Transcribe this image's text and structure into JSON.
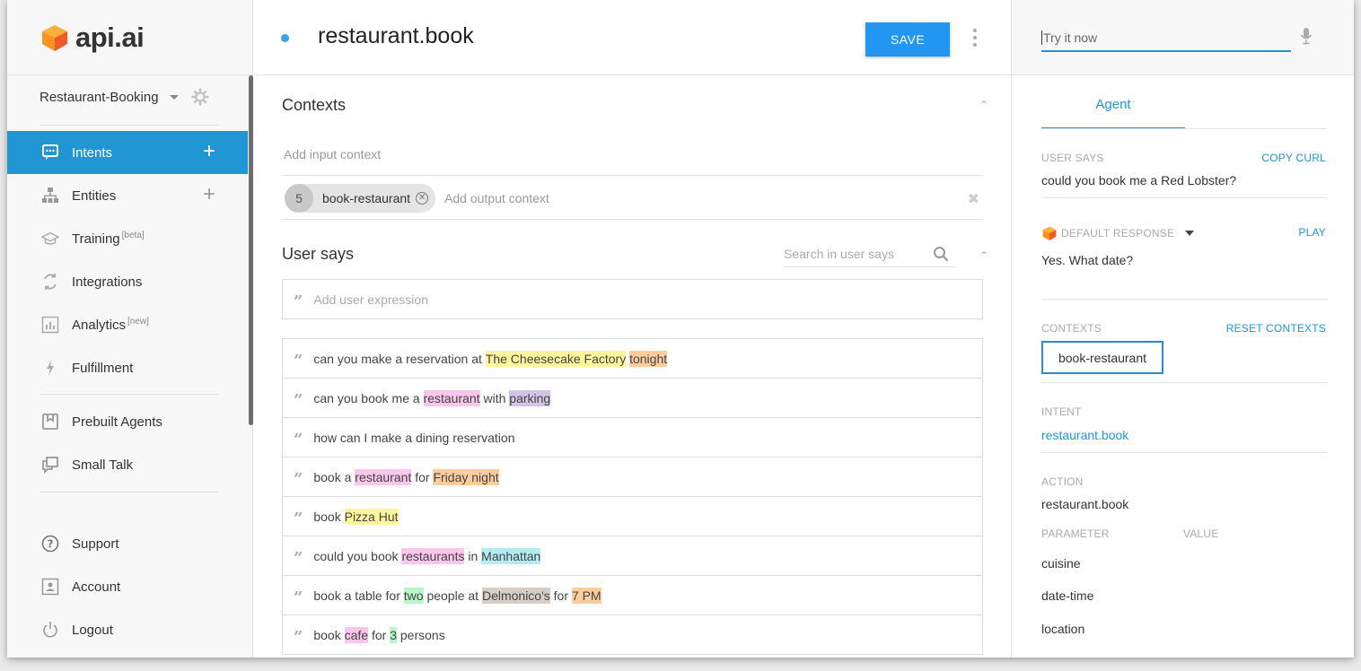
{
  "app": {
    "logo_text": "api.ai",
    "accent": "#2196d5"
  },
  "sidebar": {
    "agent_name": "Restaurant-Booking",
    "nav": [
      {
        "label": "Intents",
        "icon": "chat-icon",
        "active": true,
        "plus": "+"
      },
      {
        "label": "Entities",
        "icon": "hierarchy-icon",
        "plus": "+"
      },
      {
        "label": "Training",
        "icon": "graduation-cap-icon",
        "tag": "[beta]"
      },
      {
        "label": "Integrations",
        "icon": "refresh-icon"
      },
      {
        "label": "Analytics",
        "icon": "bar-chart-icon",
        "tag": "[new]"
      },
      {
        "label": "Fulfillment",
        "icon": "lightning-icon"
      },
      {
        "label": "Prebuilt Agents",
        "icon": "book-icon"
      },
      {
        "label": "Small Talk",
        "icon": "chat-bubbles-icon"
      },
      {
        "label": "Support",
        "icon": "help-circle-icon"
      },
      {
        "label": "Account",
        "icon": "account-icon"
      },
      {
        "label": "Logout",
        "icon": "power-icon"
      }
    ]
  },
  "main": {
    "intent_title": "restaurant.book",
    "save_label": "SAVE",
    "contexts": {
      "title": "Contexts",
      "input_placeholder": "Add input context",
      "output_chip": {
        "count": "5",
        "label": "book-restaurant"
      },
      "output_placeholder": "Add output context"
    },
    "user_says": {
      "title": "User says",
      "search_placeholder": "Search in user says",
      "add_placeholder": "Add user expression",
      "expressions": [
        [
          {
            "t": "can you make a reservation at "
          },
          {
            "t": "The Cheesecake Factory",
            "c": "#fff59d"
          },
          {
            "t": " "
          },
          {
            "t": "tonight",
            "c": "#ffcc9e"
          }
        ],
        [
          {
            "t": "can you book me a "
          },
          {
            "t": "restaurant",
            "c": "#fbc6ec"
          },
          {
            "t": " with "
          },
          {
            "t": "parking",
            "c": "#d1c4e9"
          }
        ],
        [
          {
            "t": "how can I make a dining reservation"
          }
        ],
        [
          {
            "t": "book a "
          },
          {
            "t": "restaurant",
            "c": "#fbc6ec"
          },
          {
            "t": " for "
          },
          {
            "t": "Friday night",
            "c": "#ffcc9e"
          }
        ],
        [
          {
            "t": "book "
          },
          {
            "t": "Pizza Hut",
            "c": "#fff59d"
          }
        ],
        [
          {
            "t": "could you book "
          },
          {
            "t": "restaurants",
            "c": "#fbc6ec"
          },
          {
            "t": " in "
          },
          {
            "t": "Manhattan",
            "c": "#b2ebf2"
          }
        ],
        [
          {
            "t": "book a table for "
          },
          {
            "t": "two",
            "c": "#b9f6ca"
          },
          {
            "t": " people at "
          },
          {
            "t": "Delmonico's",
            "c": "#d7ccc8"
          },
          {
            "t": " for "
          },
          {
            "t": "7 PM",
            "c": "#ffcc9e"
          }
        ],
        [
          {
            "t": "book "
          },
          {
            "t": "cafe",
            "c": "#fbc6ec"
          },
          {
            "t": " for "
          },
          {
            "t": "3",
            "c": "#b9f6ca"
          },
          {
            "t": " persons"
          }
        ]
      ]
    }
  },
  "right": {
    "try_placeholder": "Try it now",
    "tab": "Agent",
    "user_says_label": "USER SAYS",
    "copy_curl": "COPY CURL",
    "user_says_value": "could you book me a Red Lobster?",
    "default_response_label": "DEFAULT RESPONSE",
    "play": "PLAY",
    "response_value": "Yes. What date?",
    "contexts_label": "CONTEXTS",
    "reset_contexts": "RESET CONTEXTS",
    "context_value": "book-restaurant",
    "intent_label": "INTENT",
    "intent_value": "restaurant.book",
    "action_label": "ACTION",
    "action_value": "restaurant.book",
    "parameter_label": "PARAMETER",
    "value_label": "VALUE",
    "parameters": [
      "cuisine",
      "date-time",
      "location"
    ]
  }
}
